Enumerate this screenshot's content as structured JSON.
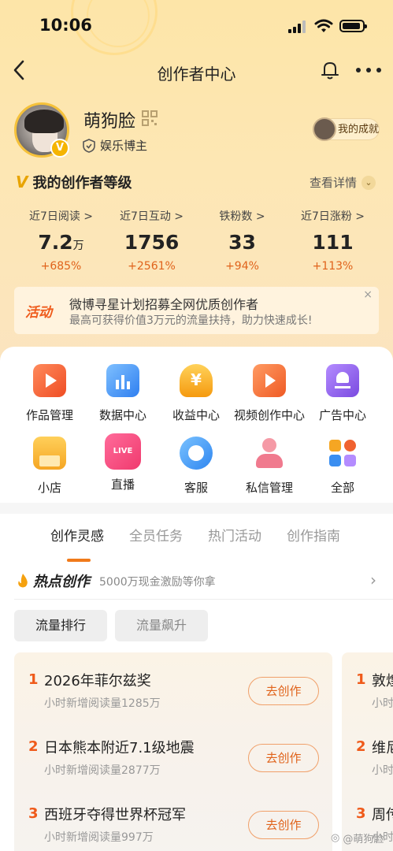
{
  "status_bar": {
    "time": "10:06"
  },
  "nav": {
    "title": "创作者中心"
  },
  "profile": {
    "name": "萌狗脸",
    "category": "娱乐博主",
    "achievement_label": "我的成就"
  },
  "level": {
    "title": "我的创作者等级",
    "detail_label": "查看详情"
  },
  "stats": [
    {
      "label": "近7日阅读 >",
      "value": "7.2",
      "unit": "万",
      "change": "+685%"
    },
    {
      "label": "近7日互动 >",
      "value": "1756",
      "unit": "",
      "change": "+2561%"
    },
    {
      "label": "铁粉数 >",
      "value": "33",
      "unit": "",
      "change": "+94%"
    },
    {
      "label": "近7日涨粉 >",
      "value": "111",
      "unit": "",
      "change": "+113%"
    }
  ],
  "banner": {
    "tag": "活动",
    "line1": "微博寻星计划招募全网优质创作者",
    "line2": "最高可获得价值3万元的流量扶持，助力快速成长!",
    "close": "×"
  },
  "tools": [
    {
      "label": "作品管理",
      "icon": "works-icon",
      "color": "#f0622f"
    },
    {
      "label": "数据中心",
      "icon": "chart-icon",
      "color": "#3a8ef0"
    },
    {
      "label": "收益中心",
      "icon": "yen-icon",
      "color": "#f5a10f"
    },
    {
      "label": "视频创作中心",
      "icon": "video-icon",
      "color": "#f26b2d"
    },
    {
      "label": "广告中心",
      "icon": "ad-icon",
      "color": "#8c5ae8"
    },
    {
      "label": "小店",
      "icon": "shop-icon",
      "color": "#f5a623"
    },
    {
      "label": "直播",
      "icon": "live-icon",
      "color": "#f0457a"
    },
    {
      "label": "客服",
      "icon": "service-icon",
      "color": "#2f8ef0"
    },
    {
      "label": "私信管理",
      "icon": "message-icon",
      "color": "#f07a8e"
    },
    {
      "label": "全部",
      "icon": "all-icon",
      "color": "#f5a623"
    }
  ],
  "tabs": [
    "创作灵感",
    "全员任务",
    "热门活动",
    "创作指南"
  ],
  "hot": {
    "title": "热点创作",
    "subtitle": "5000万现金激励等你拿"
  },
  "chips": [
    "流量排行",
    "流量飙升"
  ],
  "hot_list": [
    {
      "rank": "1",
      "title": "2026年菲尔兹奖",
      "sub": "小时新增阅读量1285万",
      "button": "去创作"
    },
    {
      "rank": "2",
      "title": "日本熊本附近7.1级地震",
      "sub": "小时新增阅读量2877万",
      "button": "去创作"
    },
    {
      "rank": "3",
      "title": "西班牙夺得世界杯冠军",
      "sub": "小时新增阅读量997万",
      "button": "去创作"
    }
  ],
  "hot_list_2": [
    {
      "rank": "1",
      "title": "敦煌",
      "sub": "小时"
    },
    {
      "rank": "2",
      "title": "维尼",
      "sub": "小时"
    },
    {
      "rank": "3",
      "title": "周传",
      "sub": "小时"
    }
  ],
  "watermark": "@萌狗脸"
}
